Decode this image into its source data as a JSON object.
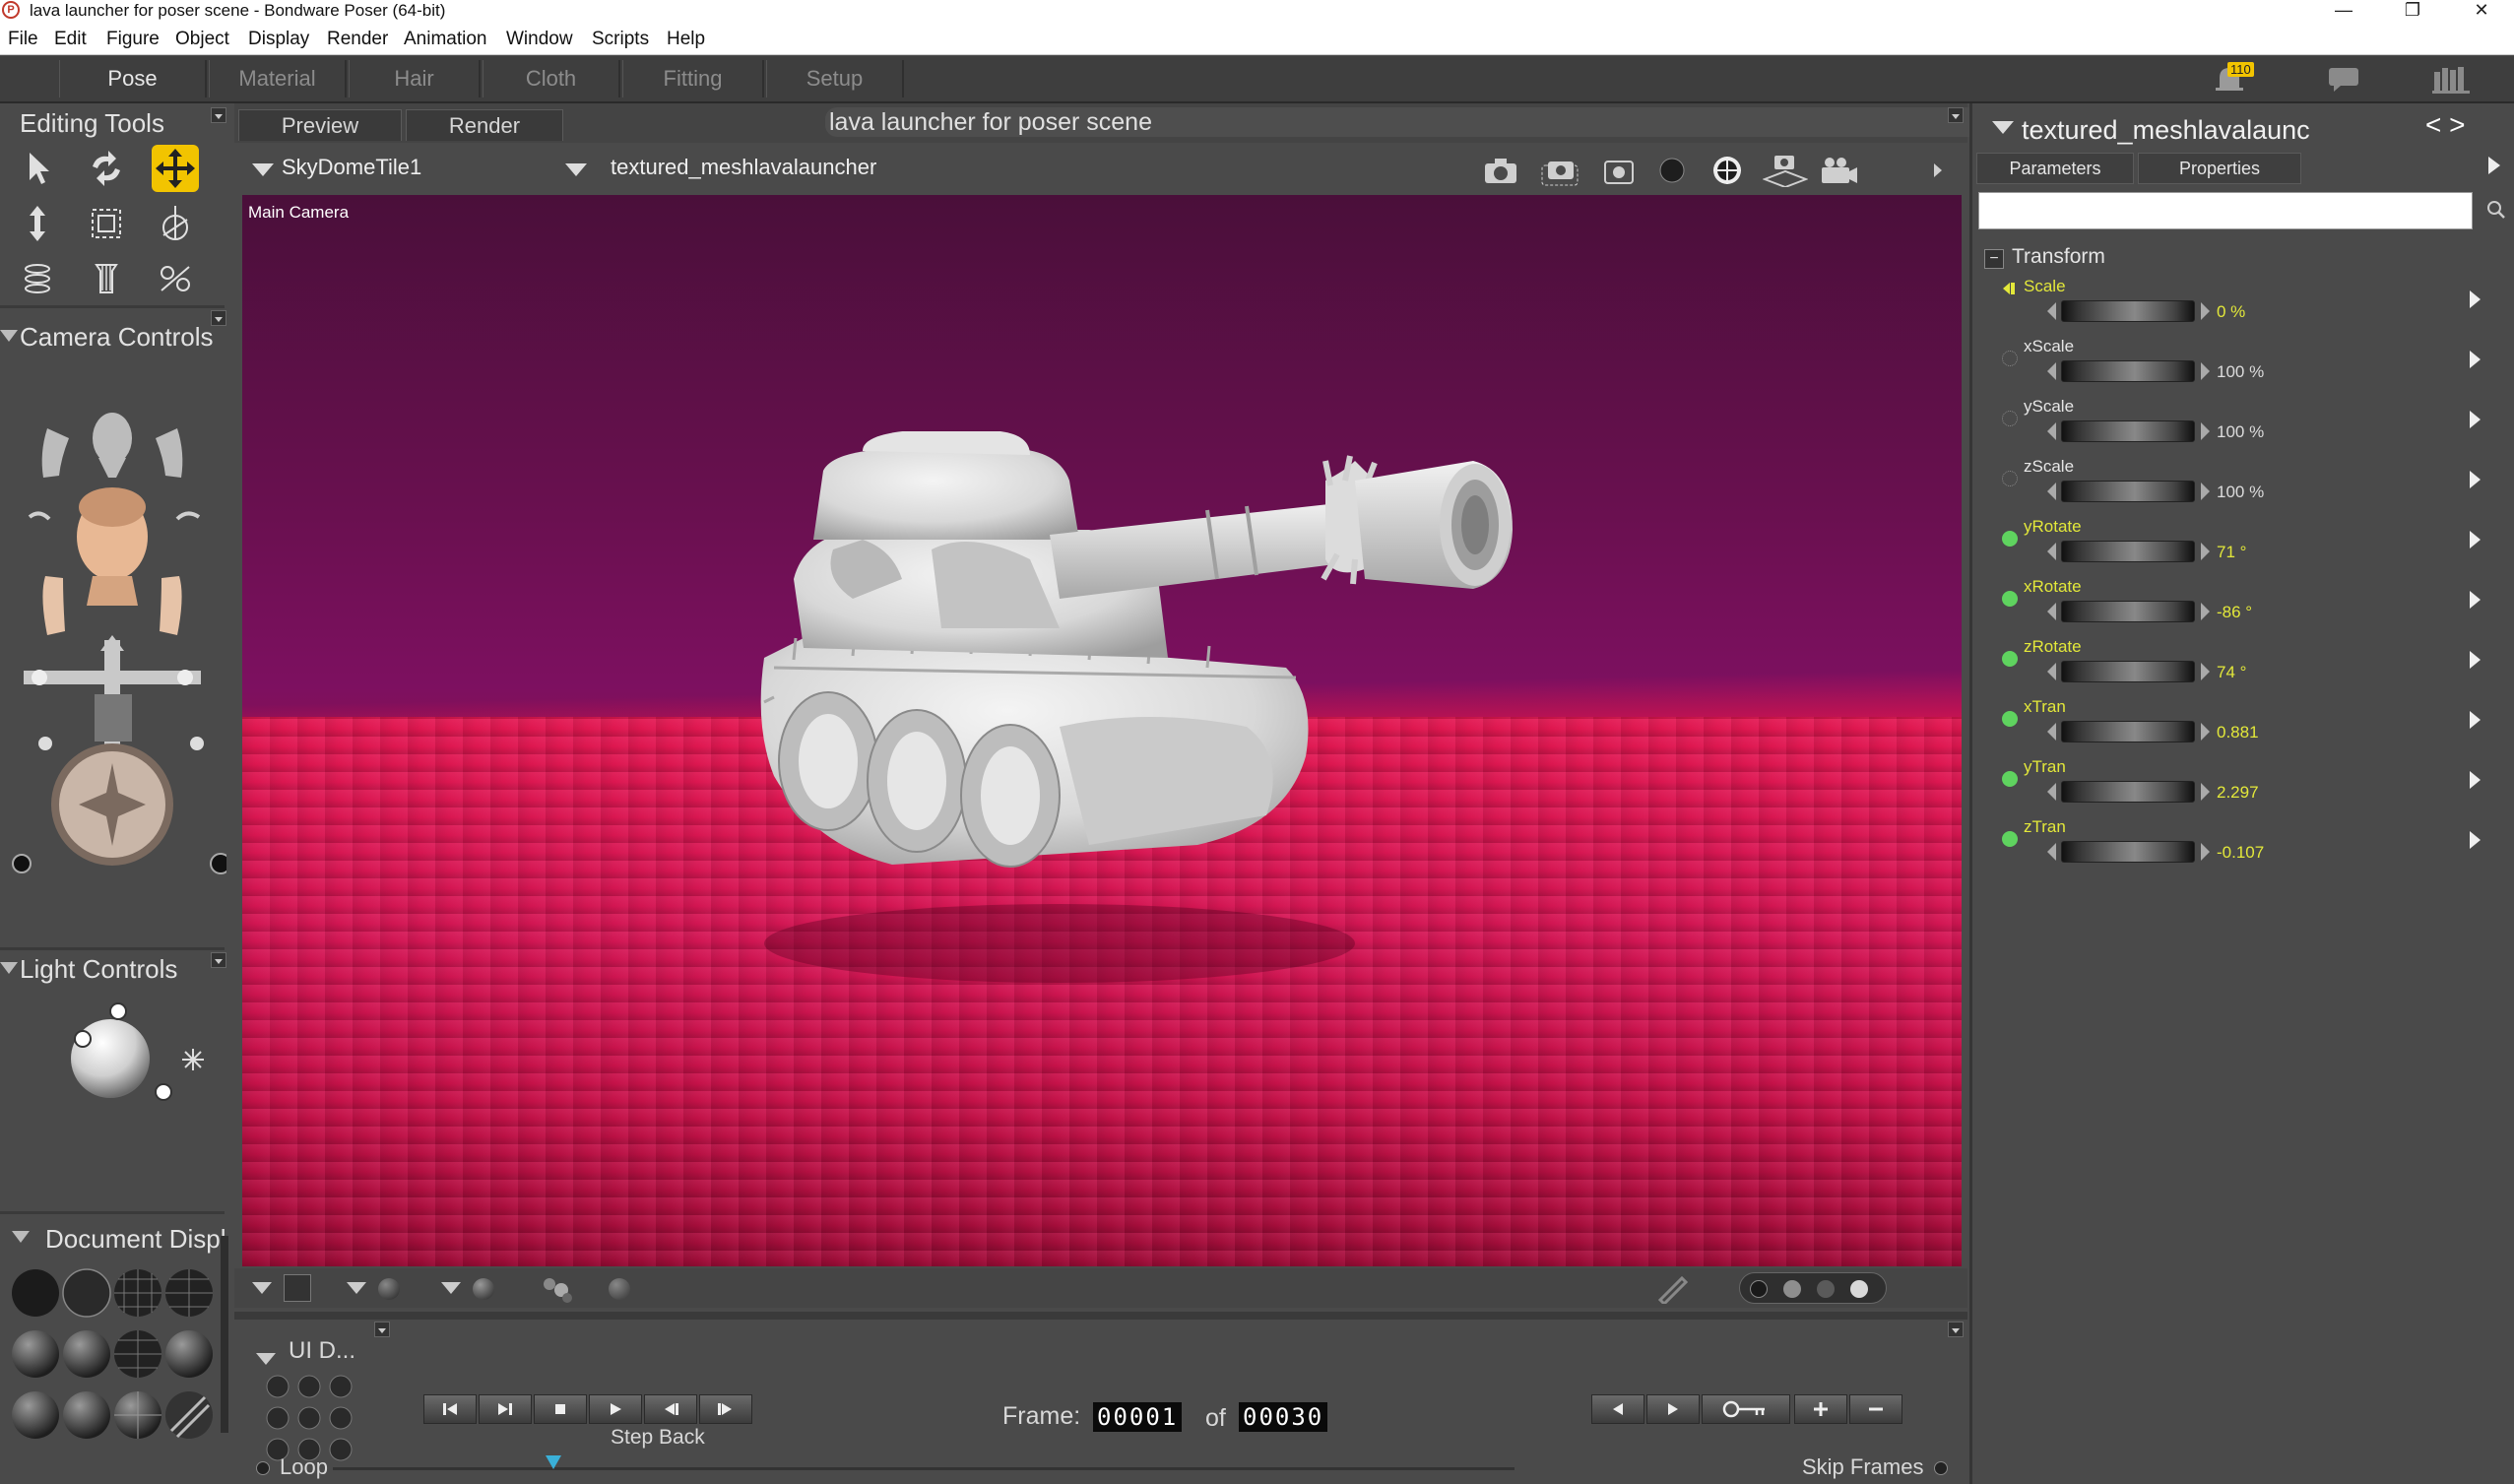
{
  "window": {
    "title": "lava launcher for poser scene - Bondware Poser (64-bit)",
    "logo_glyph": "P",
    "minimize": "—",
    "maximize": "❐",
    "close": "✕"
  },
  "menu": [
    "File",
    "Edit",
    "Figure",
    "Object",
    "Display",
    "Render",
    "Animation",
    "Window",
    "Scripts",
    "Help"
  ],
  "rooms": [
    "Pose",
    "Material",
    "Hair",
    "Cloth",
    "Fitting",
    "Setup"
  ],
  "notification_count": "110",
  "left": {
    "editing_tools_title": "Editing Tools",
    "camera_controls_title": "Camera Controls",
    "light_controls_title": "Light Controls",
    "document_display_title": "Document  Displ",
    "ui_dots_title": "UI D..."
  },
  "document": {
    "tab_preview": "Preview",
    "tab_render": "Render",
    "title": "lava launcher for poser scene",
    "figure_dropdown": "SkyDomeTile1",
    "actor_dropdown": "textured_meshlavalauncher",
    "camera_name": "Main Camera"
  },
  "timeline": {
    "frame_label": "Frame:",
    "frame_current": "00001",
    "of_label": "of",
    "frame_total": "00030",
    "tooltip": "Step Back",
    "loop_label": "Loop",
    "skip_frames_label": "Skip Frames"
  },
  "right": {
    "actor_title": "textured_meshlavalaunc",
    "nav_glyph": "< >",
    "tab_parameters": "Parameters",
    "tab_properties": "Properties",
    "search_value": "",
    "group_title": "Transform",
    "group_toggle": "−",
    "params": [
      {
        "name": "Scale",
        "value": "0 %",
        "highlight": true,
        "dot": "key"
      },
      {
        "name": "xScale",
        "value": "100 %",
        "highlight": false,
        "dot": "off"
      },
      {
        "name": "yScale",
        "value": "100 %",
        "highlight": false,
        "dot": "off"
      },
      {
        "name": "zScale",
        "value": "100 %",
        "highlight": false,
        "dot": "off"
      },
      {
        "name": "yRotate",
        "value": "71 °",
        "highlight": true,
        "dot": "on"
      },
      {
        "name": "xRotate",
        "value": "-86 °",
        "highlight": true,
        "dot": "on"
      },
      {
        "name": "zRotate",
        "value": "74 °",
        "highlight": true,
        "dot": "on"
      },
      {
        "name": "xTran",
        "value": "0.881",
        "highlight": true,
        "dot": "on"
      },
      {
        "name": "yTran",
        "value": "2.297",
        "highlight": true,
        "dot": "on"
      },
      {
        "name": "zTran",
        "value": "-0.107",
        "highlight": true,
        "dot": "on"
      }
    ]
  },
  "colors": {
    "accent": "#f2c400",
    "param_highlight": "#e3e83a",
    "key_dot": "#5fd35f",
    "sky": "#6a1050",
    "ground": "#e0174f"
  }
}
